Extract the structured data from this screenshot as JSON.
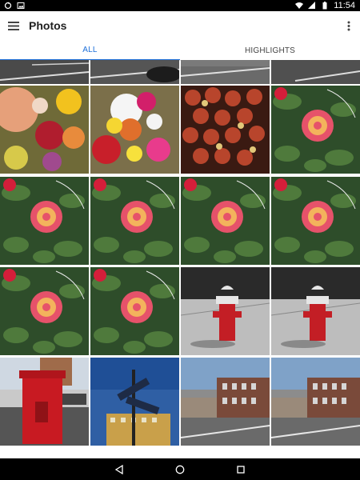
{
  "status_bar": {
    "time": "11:54",
    "icons": [
      "sync-icon",
      "image-icon",
      "wifi-icon",
      "signal-icon",
      "battery-icon"
    ]
  },
  "app_bar": {
    "title": "Photos",
    "menu_icon": "menu-icon",
    "overflow_icon": "more-vert-icon"
  },
  "tabs": [
    {
      "label": "ALL",
      "active": true
    },
    {
      "label": "HIGHLIGHTS",
      "active": false
    }
  ],
  "photos": [
    "street-crosswalk",
    "street-car",
    "street-sidewalk",
    "street-road",
    "flower-bouquet",
    "flower-bouquet-daisies",
    "apples-bin",
    "rose-bush",
    "rose-bush",
    "rose-bush",
    "rose-bush",
    "rose-bush",
    "rose-bush",
    "rose-bush",
    "fire-hydrant",
    "fire-hydrant",
    "red-mailbox",
    "street-signs",
    "brick-buildings",
    "brick-buildings"
  ],
  "nav_bar": {
    "back_icon": "back-icon",
    "home_icon": "home-icon",
    "recents_icon": "recents-icon"
  }
}
